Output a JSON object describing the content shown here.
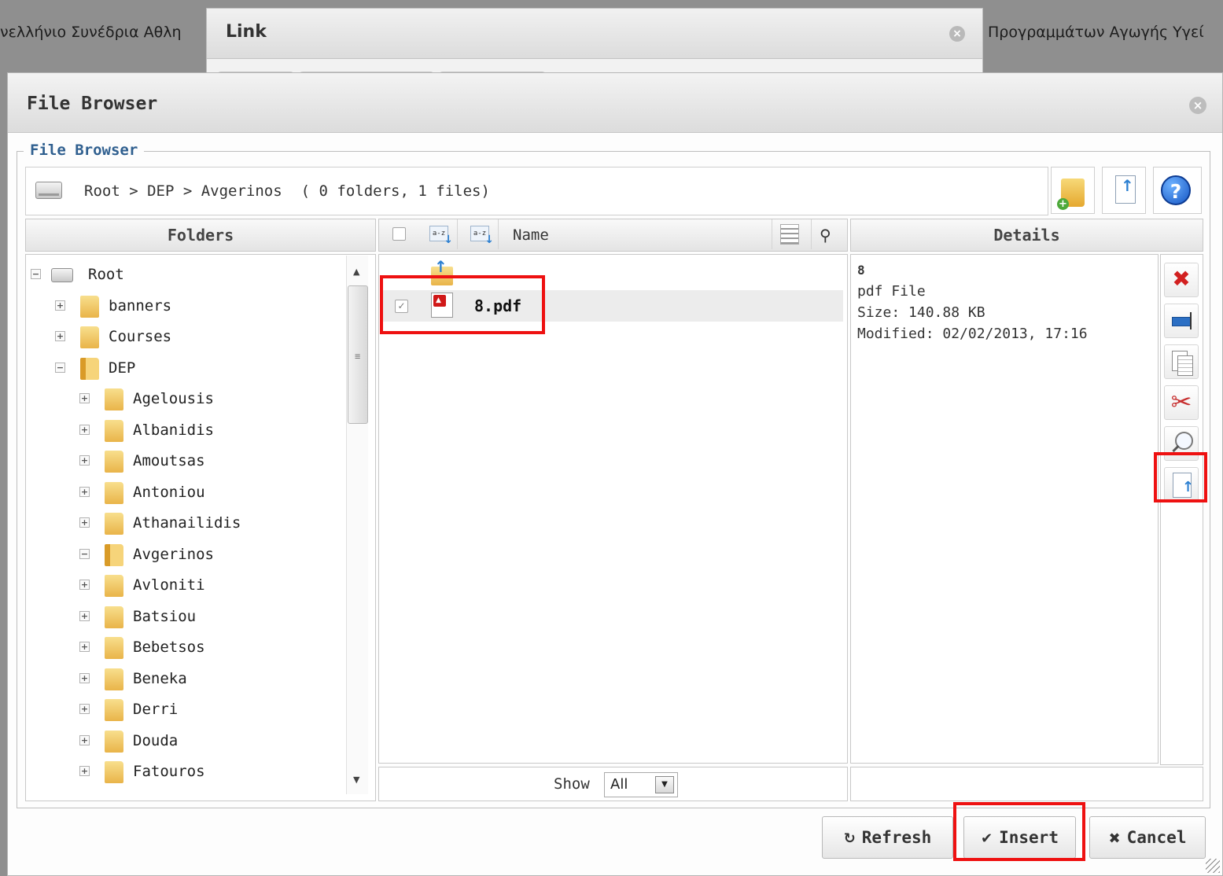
{
  "background": {
    "left_text": "νελλήνιο Συνέδρια Αθλη",
    "right_text": "Προγραμμάτων Αγωγής Υγεί"
  },
  "link_dialog": {
    "title": "Link",
    "close_icon": "close-icon"
  },
  "file_browser": {
    "title": "File Browser",
    "legend": "File Browser",
    "close_icon": "close-icon"
  },
  "path": {
    "breadcrumb": "Root > DEP > Avgerinos",
    "count": "( 0 folders, 1 files)",
    "icon": "drive-icon"
  },
  "toolbar": {
    "new_folder_icon": "new-folder-icon",
    "upload_icon": "upload-icon",
    "help_icon": "help-icon",
    "help_glyph": "?"
  },
  "columns": {
    "folders": "Folders",
    "name": "Name",
    "details": "Details"
  },
  "tree": {
    "root": "Root",
    "items": [
      {
        "label": "banners",
        "expander": "+"
      },
      {
        "label": "Courses",
        "expander": "+"
      },
      {
        "label": "DEP",
        "expander": "−"
      },
      {
        "label": "Agelousis",
        "expander": "+"
      },
      {
        "label": "Albanidis",
        "expander": "+"
      },
      {
        "label": "Amoutsas",
        "expander": "+"
      },
      {
        "label": "Antoniou",
        "expander": "+"
      },
      {
        "label": "Athanailidis",
        "expander": "+"
      },
      {
        "label": "Avgerinos",
        "expander": "−"
      },
      {
        "label": "Avloniti",
        "expander": "+"
      },
      {
        "label": "Batsiou",
        "expander": "+"
      },
      {
        "label": "Bebetsos",
        "expander": "+"
      },
      {
        "label": "Beneka",
        "expander": "+"
      },
      {
        "label": "Derri",
        "expander": "+"
      },
      {
        "label": "Douda",
        "expander": "+"
      },
      {
        "label": "Fatouros",
        "expander": "+"
      }
    ]
  },
  "files": [
    {
      "name": "8.pdf",
      "type_icon": "pdf-icon",
      "checked": true
    }
  ],
  "sort_icons": [
    "a-z",
    "a-z"
  ],
  "show": {
    "label": "Show",
    "value": "All"
  },
  "details": {
    "title": "8",
    "type": "pdf File",
    "size": "Size: 140.88 KB",
    "modified": "Modified: 02/02/2013, 17:16"
  },
  "actions": [
    "delete-icon",
    "rename-icon",
    "copy-icon",
    "cut-icon",
    "preview-icon",
    "upload-icon"
  ],
  "buttons": {
    "refresh": "Refresh",
    "insert": "Insert",
    "cancel": "Cancel",
    "refresh_glyph": "↻",
    "insert_glyph": "✔",
    "cancel_glyph": "✖"
  },
  "colors": {
    "highlight": "#ee1111",
    "legend_text": "#2f5f8f",
    "delete_red": "#d22020"
  }
}
